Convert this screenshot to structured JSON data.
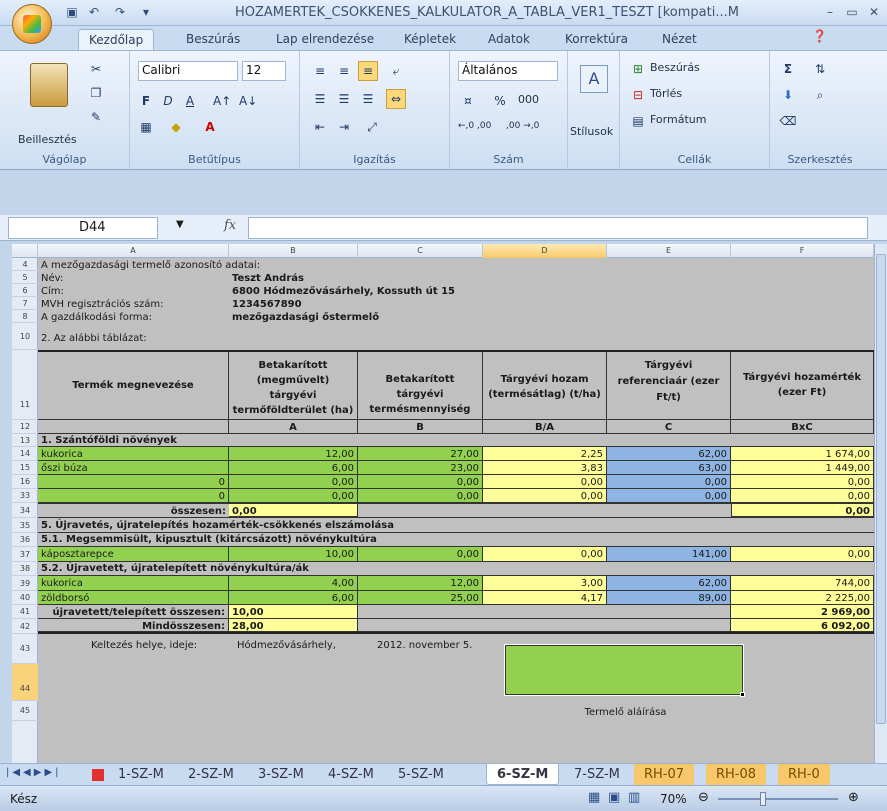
{
  "app": {
    "title": "HOZAMERTEK_CSOKKENES_KALKULATOR_A_TABLA_VER1_TESZT  [kompati...M"
  },
  "ribbon_tabs": [
    "Kezdőlap",
    "Beszúrás",
    "Lap elrendezése",
    "Képletek",
    "Adatok",
    "Korrektúra",
    "Nézet"
  ],
  "groups": {
    "clipboard": {
      "label": "Vágólap",
      "paste": "Beillesztés"
    },
    "font": {
      "label": "Betűtípus",
      "name": "Calibri",
      "size": "12",
      "bold": "F",
      "italic": "D",
      "underline": "A"
    },
    "align": {
      "label": "Igazítás"
    },
    "number": {
      "label": "Szám",
      "format": "Általános",
      "percent": "%",
      "thousands": "000",
      "inc": "←,0 ,00",
      "dec": ",00 →,0"
    },
    "styles": {
      "label": "Stílusok"
    },
    "cells": {
      "label": "Cellák",
      "insert": "Beszúrás",
      "delete": "Törlés",
      "format": "Formátum"
    },
    "editing": {
      "label": "Szerkesztés"
    }
  },
  "formula": {
    "name_box": "D44",
    "fx": "fx",
    "value": ""
  },
  "columns": [
    "A",
    "B",
    "C",
    "D",
    "E",
    "F"
  ],
  "rows_index": [
    "4",
    "5",
    "6",
    "7",
    "8",
    "10",
    "11",
    "12",
    "13",
    "14",
    "15",
    "16",
    "33",
    "34",
    "35",
    "36",
    "37",
    "38",
    "39",
    "40",
    "41",
    "42",
    "43",
    "44",
    "45"
  ],
  "info": {
    "r4": "A mezőgazdasági termelő azonosító adatai:",
    "name_l": "Név:",
    "name_v": "Teszt András",
    "addr_l": "Cím:",
    "addr_v": "6800 Hódmezővásárhely, Kossuth út 15",
    "mvh_l": "MVH regisztrációs szám:",
    "mvh_v": "1234567890",
    "form_l": "A gazdálkodási forma:",
    "form_v": "mezőgazdasági őstermelő",
    "r10": "2. Az alábbi táblázat:"
  },
  "table": {
    "headers": [
      "Termék megnevezése",
      "Betakarított (megművelt) tárgyévi termőföldterület (ha)",
      "Betakarított tárgyévi termésmennyiség (t)",
      "Tárgyévi hozam (termésátlag) (t/ha)",
      "Tárgyévi referenciaár (ezer Ft/t)",
      "Tárgyévi hozamérték (ezer Ft)"
    ],
    "codes": [
      "",
      "A",
      "B",
      "B/A",
      "C",
      "BxC"
    ],
    "sec1": "1. Szántóföldi növények",
    "rows1": [
      [
        "kukorica",
        "12,00",
        "27,00",
        "2,25",
        "62,00",
        "1 674,00"
      ],
      [
        "őszi búza",
        "6,00",
        "23,00",
        "3,83",
        "63,00",
        "1 449,00"
      ],
      [
        "0",
        "0,00",
        "0,00",
        "0,00",
        "0,00",
        "0,00"
      ],
      [
        "0",
        "0,00",
        "0,00",
        "0,00",
        "0,00",
        "0,00"
      ]
    ],
    "sum1_label": "összesen:",
    "sum1_a": "0,00",
    "sum1_f": "0,00",
    "sec5": "5. Újravetés, újratelepítés hozamérték-csökkenés elszámolása",
    "sec51": "5.1. Megsemmisült, kipusztult (kitárcsázott) növénykultúra",
    "row51": [
      "káposztarepce",
      "10,00",
      "0,00",
      "0,00",
      "141,00",
      "0,00"
    ],
    "sec52": "5.2. Újravetett, újratelepített növénykultúra/ák",
    "rows52": [
      [
        "kukorica",
        "4,00",
        "12,00",
        "3,00",
        "62,00",
        "744,00"
      ],
      [
        "zöldborsó",
        "6,00",
        "25,00",
        "4,17",
        "89,00",
        "2 225,00"
      ]
    ],
    "sum52_label": "újravetett/telepített összesen:",
    "sum52_a": "10,00",
    "sum52_f": "2 969,00",
    "total_label": "Mindösszesen:",
    "total_a": "28,00",
    "total_f": "6 092,00"
  },
  "footer": {
    "place_label": "Keltezés helye, ideje:",
    "place": "Hódmezővásárhely,",
    "date": "2012. november 5.",
    "signature": "Termelő aláírása"
  },
  "sheet_tabs": [
    "1-SZ-M",
    "2-SZ-M",
    "3-SZ-M",
    "4-SZ-M",
    "5-SZ-M",
    "6-SZ-M",
    "7-SZ-M",
    "RH-07",
    "RH-08",
    "RH-0"
  ],
  "status": {
    "ready": "Kész",
    "zoom": "70%"
  }
}
